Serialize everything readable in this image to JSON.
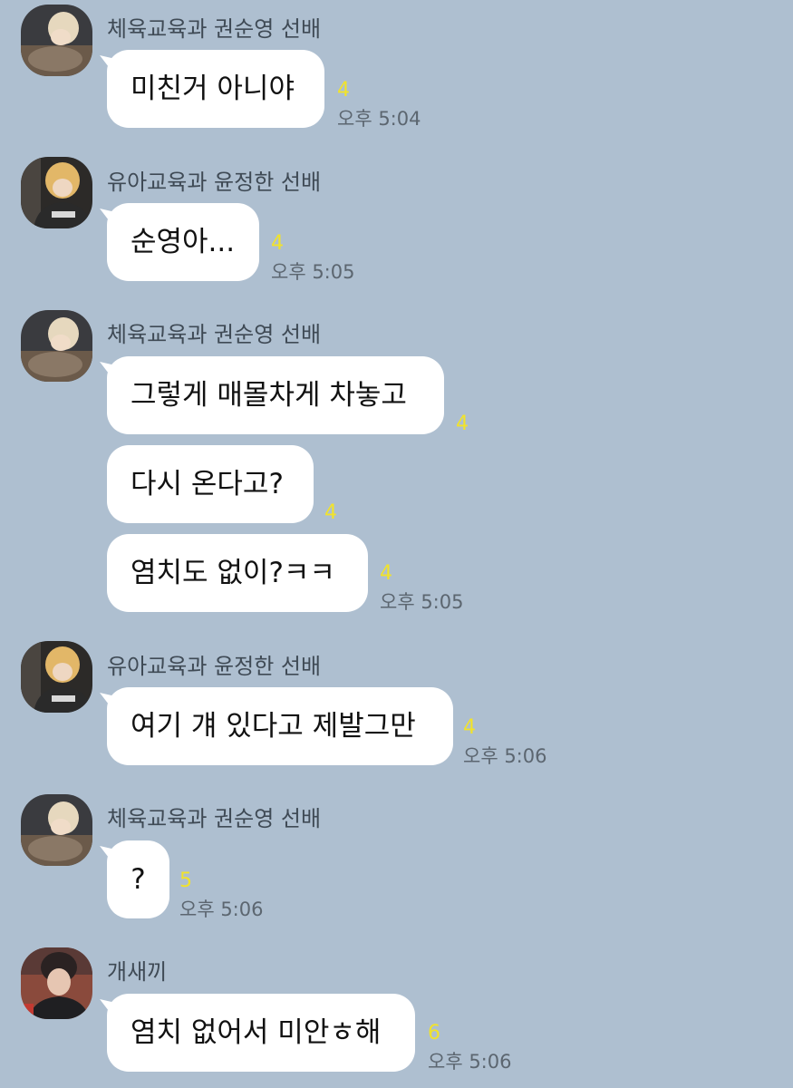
{
  "senders": {
    "kwon": "체육교육과 권순영 선배",
    "yoon": "유아교육과 윤정한 선배",
    "dog": "개새끼"
  },
  "messages": [
    {
      "text": "미친거 아니야",
      "unread": "4",
      "time": "오후 5:04"
    },
    {
      "text": "순영아...",
      "unread": "4",
      "time": "오후 5:05"
    },
    {
      "text": "그렇게 매몰차게 차놓고",
      "unread": "4"
    },
    {
      "text": "다시 온다고?",
      "unread": "4"
    },
    {
      "text": "염치도 없이?ㅋㅋ",
      "unread": "4",
      "time": "오후 5:05"
    },
    {
      "text": "여기 걔 있다고 제발그만",
      "unread": "4",
      "time": "오후 5:06"
    },
    {
      "text": "?",
      "unread": "5",
      "time": "오후 5:06"
    },
    {
      "text": "염치 없어서 미안ㅎ해",
      "unread": "6",
      "time": "오후 5:06"
    }
  ],
  "colors": {
    "background": "#aebfd0",
    "bubble": "#ffffff",
    "unread": "#f2e32a"
  }
}
